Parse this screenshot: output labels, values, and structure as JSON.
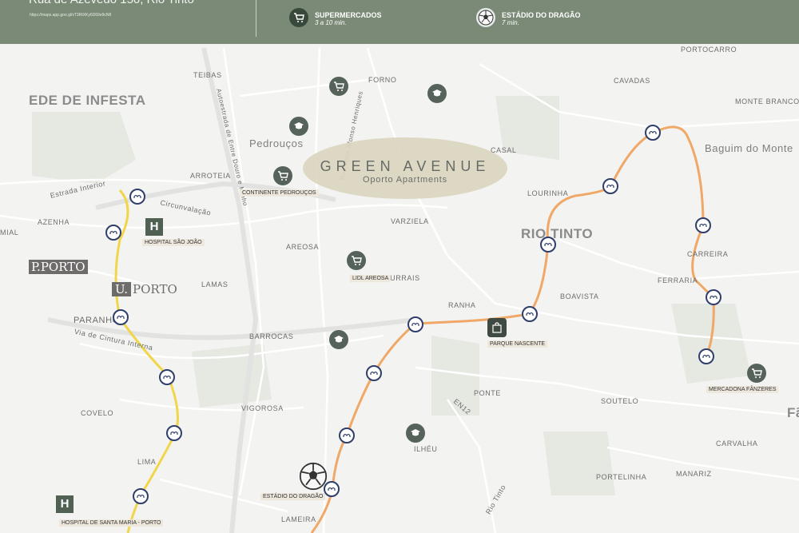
{
  "header": {
    "address": "Rua de Azevedo 150, Rio Tinto",
    "url": "https://maps.app.goo.gl/xT3RtXKy6D69e9cN8",
    "items": [
      {
        "icon": "cart-icon",
        "title": "SUPERMERCADOS",
        "sub": "3 a 10 min."
      },
      {
        "icon": "soccer-ball-icon",
        "title": "ESTÁDIO DO DRAGÃO",
        "sub": "7 min."
      }
    ]
  },
  "places": {
    "ede_infesta": "EDE DE INFESTA",
    "pedroucos": "Pedrouços",
    "rio_tinto": "RIO TINTO",
    "baguim": "Baguim do Monte",
    "fa": "Fã",
    "forno": "FORNO",
    "teibas": "TEIBAS",
    "cavadas": "CAVADAS",
    "portocarro": "PORTOCARRO",
    "monte_branco": "MONTE BRANCO",
    "casal": "CASAL",
    "lourinha": "LOURINHA",
    "varziela": "VARZIELA",
    "areosa": "AREOSA",
    "arroteia": "ARROTEIA",
    "azenha": "AZENHA",
    "mial": "MIAL",
    "lamas": "LAMAS",
    "paranhos": "PARANHOS",
    "barrocas": "BARROCAS",
    "ranha": "RANHA",
    "boavista": "BOAVISTA",
    "carreira": "CARREIRA",
    "ferraria": "FERRARIA",
    "currais": "CURRAIS",
    "ponte": "PONTE",
    "soutelo": "SOUTELO",
    "carvalha": "CARVALHA",
    "covelo": "COVELO",
    "vigorosa": "VIGOROSA",
    "ilheu": "ILHÉU",
    "lima": "LIMA",
    "portelinha": "PORTELINHA",
    "manariz": "MANARIZ",
    "lameira": "LAMEIRA"
  },
  "roads": {
    "estrada_interior": "Estrada Interior",
    "circunvalacao": "Circunvalação",
    "via_cintura": "Via de Cintura Interna",
    "autoestrada": "Autoestrada de Entre Douro e Minho",
    "rua_afonso": "Rua Dom Afonso Henriques",
    "en12": "EN12",
    "rio_tinto_river": "Rio Tinto"
  },
  "pois": [
    {
      "key": "continente",
      "label": "CONTINENTE PEDROUÇOS"
    },
    {
      "key": "hospital_sj",
      "label": "HOSPITAL SÃO JOÃO"
    },
    {
      "key": "lidl",
      "label": "LIDL AREOSA"
    },
    {
      "key": "parque",
      "label": "PARQUE NASCENTE"
    },
    {
      "key": "mercadona",
      "label": "MERCADONA FÂNZERES"
    },
    {
      "key": "estadio",
      "label": "ESTÁDIO DO DRAGÃO"
    },
    {
      "key": "hospital_sm",
      "label": "HOSPITAL DE SANTA MARIA - PORTO"
    }
  ],
  "logos": {
    "pporto": "P.PORTO",
    "uporto_u": "U.",
    "uporto_rest": "PORTO"
  },
  "property": {
    "name": "GREEN AVENUE",
    "sub": "Oporto Apartments"
  },
  "colors": {
    "header": "#7a8a76",
    "poi": "#55635a",
    "metro_orange": "#f0a868",
    "metro_yellow": "#f1d64a",
    "metro_ring": "#2f3e6b"
  }
}
